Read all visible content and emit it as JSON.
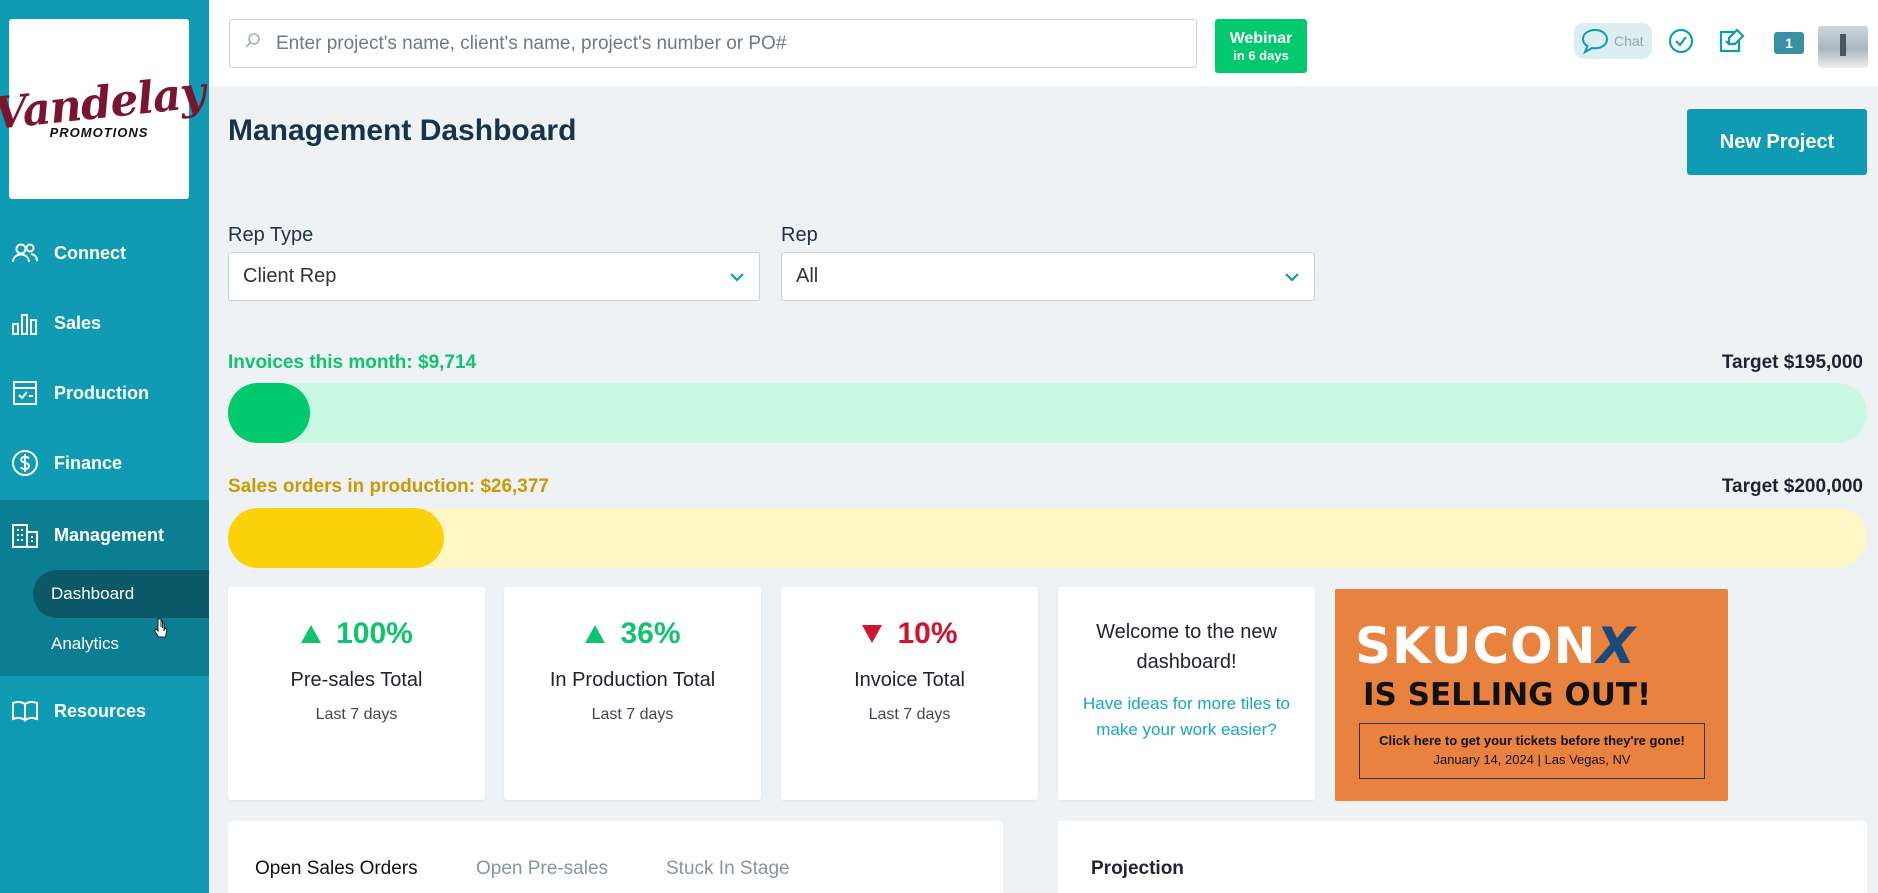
{
  "brand": {
    "logo_main": "Vandelay",
    "logo_sub": "PROMOTIONS"
  },
  "sidebar": {
    "items": [
      {
        "label": "Connect",
        "icon": "people-icon"
      },
      {
        "label": "Sales",
        "icon": "bar-chart-icon"
      },
      {
        "label": "Production",
        "icon": "checklist-icon"
      },
      {
        "label": "Finance",
        "icon": "dollar-icon"
      },
      {
        "label": "Management",
        "icon": "building-icon"
      },
      {
        "label": "Resources",
        "icon": "book-icon"
      }
    ],
    "submenu": [
      {
        "label": "Dashboard"
      },
      {
        "label": "Analytics"
      }
    ]
  },
  "topbar": {
    "search_placeholder": "Enter project's name, client's name, project's number or PO#",
    "webinar_title": "Webinar",
    "webinar_sub": "in 6 days",
    "chat_label": "Chat",
    "notification_count": "1"
  },
  "main": {
    "title": "Management Dashboard",
    "new_project_label": "New Project",
    "filters": {
      "rep_type_label": "Rep Type",
      "rep_type_value": "Client Rep",
      "rep_label": "Rep",
      "rep_value": "All"
    },
    "invoices": {
      "label": "Invoices this month: $9,714",
      "target": "Target $195,000",
      "progress": 0.0498,
      "color": "#02c86e",
      "track_color": "#c9f8e3",
      "label_color": "#0ec46e"
    },
    "sales_orders": {
      "label": "Sales orders in production: $26,377",
      "target": "Target $200,000",
      "progress": 0.1319,
      "color": "#fdd10a",
      "track_color": "#fff7c6",
      "label_color": "#c99a06"
    },
    "tiles": [
      {
        "pct": "100%",
        "direction": "up",
        "name": "Pre-sales Total",
        "period": "Last 7 days"
      },
      {
        "pct": "36%",
        "direction": "up",
        "name": "In Production Total",
        "period": "Last 7 days"
      },
      {
        "pct": "10%",
        "direction": "down",
        "name": "Invoice Total",
        "period": "Last 7 days"
      }
    ],
    "welcome": {
      "title": "Welcome to the new dashboard!",
      "link": "Have ideas for more tiles to make your work easier?"
    },
    "promo": {
      "headline": "SKUCON",
      "headline_x": "X",
      "subhead": "IS SELLING OUT!",
      "cta": "Click here to get your tickets before they're gone!",
      "event": "January 14, 2024 | Las Vegas, NV"
    },
    "tabs": [
      {
        "label": "Open Sales Orders"
      },
      {
        "label": "Open Pre-sales"
      },
      {
        "label": "Stuck In Stage"
      }
    ],
    "projection_title": "Projection"
  },
  "colors": {
    "accent": "#0e9bb3",
    "up": "#0ec46e",
    "down": "#d0132f"
  }
}
